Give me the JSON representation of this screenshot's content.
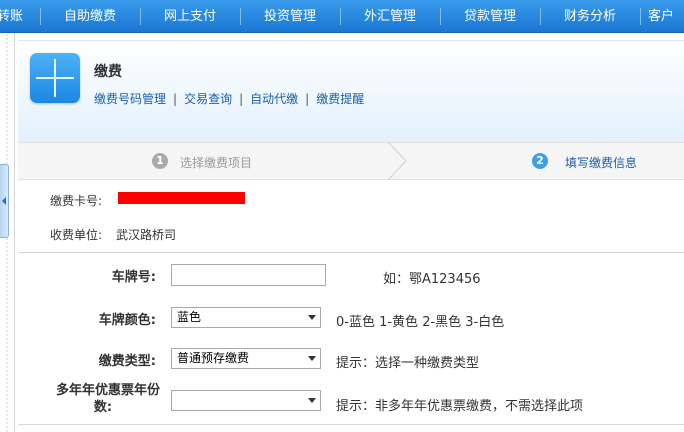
{
  "nav": {
    "items": [
      "转账",
      "自助缴费",
      "网上支付",
      "投资管理",
      "外汇管理",
      "贷款管理",
      "财务分析",
      "客户"
    ]
  },
  "header": {
    "title": "缴费",
    "links": [
      "缴费号码管理",
      "交易查询",
      "自动代缴",
      "缴费提醒"
    ],
    "separator": "|"
  },
  "steps": [
    {
      "number": "1",
      "label": "选择缴费项目"
    },
    {
      "number": "2",
      "label": "填写缴费信息"
    }
  ],
  "info": {
    "card_label": "缴费卡号:",
    "payee_label": "收费单位:",
    "payee_value": "武汉路桥司"
  },
  "form": {
    "plate_label": "车牌号:",
    "plate_value": "",
    "plate_hint": "如：鄂A123456",
    "color_label": "车牌颜色:",
    "color_selected": "蓝色",
    "color_hint": "0-蓝色 1-黄色 2-黑色 3-白色",
    "type_label": "缴费类型:",
    "type_selected": "普通预存缴费",
    "type_hint": "提示：选择一种缴费类型",
    "years_label_line1": "多年年优惠票年份",
    "years_label_line2": "数:",
    "years_selected": "",
    "years_hint": "提示：非多年年优惠票缴费，不需选择此项"
  },
  "colors": {
    "nav_bg": "#2a8ae2",
    "link": "#1a5fa8",
    "active_step": "#3f9ee8",
    "redaction": "#ff0000"
  }
}
